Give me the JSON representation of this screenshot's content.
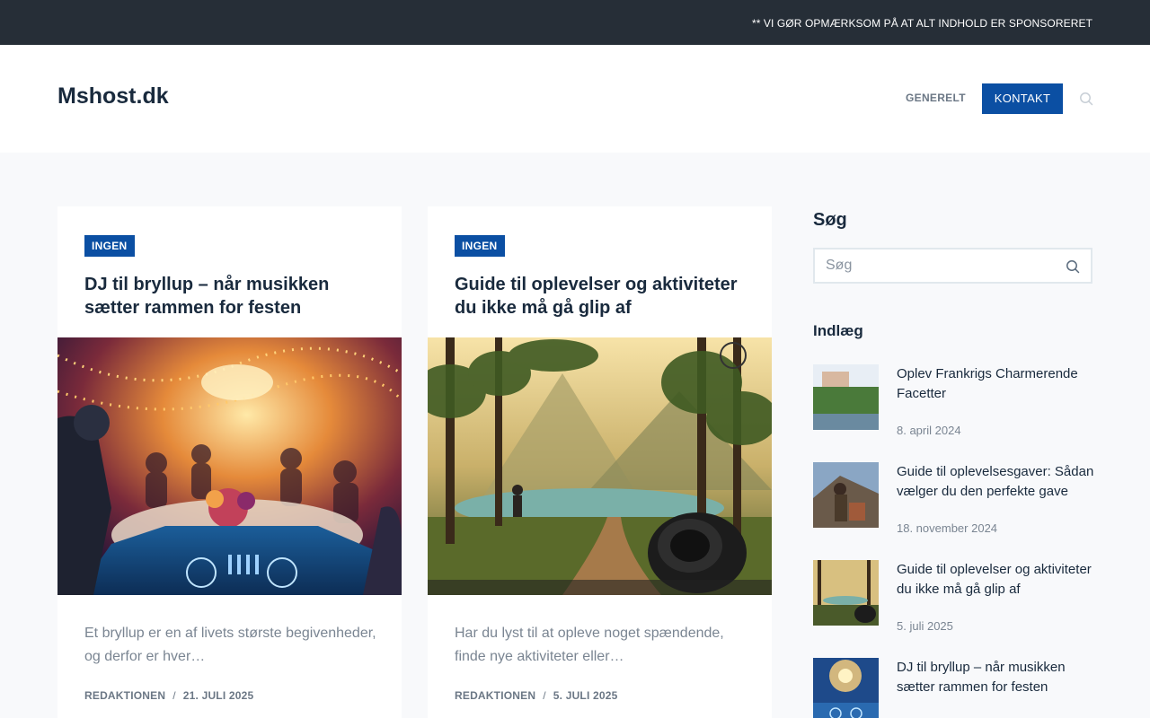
{
  "topbar": {
    "notice": "** VI GØR OPMÆRKSOM PÅ AT ALT INDHOLD ER SPONSORERET"
  },
  "header": {
    "logo": "Mshost.dk",
    "nav": {
      "generelt": "GENERELT",
      "kontakt": "KONTAKT"
    },
    "search_icon": "search-icon"
  },
  "colors": {
    "accent": "#0b4fa3",
    "topbar": "#262e37",
    "heading": "#192a3d"
  },
  "cards": [
    {
      "badge": "INGEN",
      "title": "DJ til bryllup – når musikken sætter rammen for festen",
      "excerpt": "Et bryllup er en af livets største begivenheder, og derfor er hver…",
      "author": "REDAKTIONEN",
      "date": "21. JULI 2025"
    },
    {
      "badge": "INGEN",
      "title": "Guide til oplevelser og aktiviteter du ikke må gå glip af",
      "excerpt": "Har du lyst til at opleve noget spændende, finde nye aktiviteter eller…",
      "author": "REDAKTIONEN",
      "date": "5. JULI 2025"
    }
  ],
  "sidebar": {
    "search_heading": "Søg",
    "search_placeholder": "Søg",
    "posts_heading": "Indlæg",
    "posts": [
      {
        "title": "Oplev Frankrigs Charmerende Facetter",
        "date": "8. april 2024"
      },
      {
        "title": "Guide til oplevelsesgaver: Sådan vælger du den perfekte gave",
        "date": "18. november 2024"
      },
      {
        "title": "Guide til oplevelser og aktiviteter du ikke må gå glip af",
        "date": "5. juli 2025"
      },
      {
        "title": "DJ til bryllup – når musikken sætter rammen for festen",
        "date": ""
      }
    ]
  }
}
